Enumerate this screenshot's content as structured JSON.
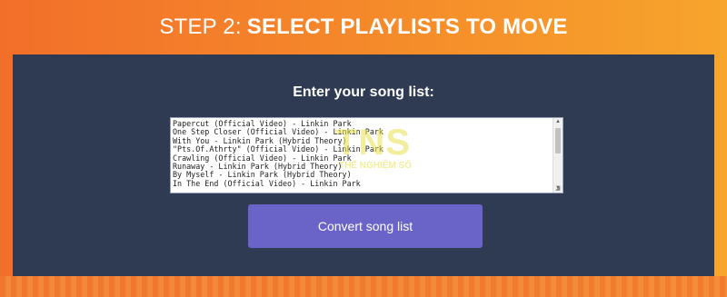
{
  "header": {
    "step": "STEP 2:",
    "title": "SELECT PLAYLISTS TO MOVE"
  },
  "panel": {
    "prompt": "Enter your song list:",
    "songs": [
      "Papercut (Official Video) - Linkin Park",
      "One Step Closer (Official Video) - Linkin Park",
      "With You - Linkin Park (Hybrid Theory)",
      "\"Pts.Of.Athrty\" (Official Video) - Linkin Park",
      "Crawling (Official Video) - Linkin Park",
      "Runaway - Linkin Park (Hybrid Theory)",
      "By Myself - Linkin Park (Hybrid Theory)",
      "In The End (Official Video) - Linkin Park"
    ],
    "convert_label": "Convert song list"
  },
  "watermark": {
    "logo": "TNS",
    "subtitle": "THẾ NGHIỆM SỐ"
  },
  "colors": {
    "panel": "#2f3b52",
    "button": "#6a64c8",
    "accent_orange": "#f5892a"
  },
  "icons": {
    "scroll_up": "triangle-up",
    "scroll_down": "triangle-down",
    "resize": "resize-grip"
  }
}
